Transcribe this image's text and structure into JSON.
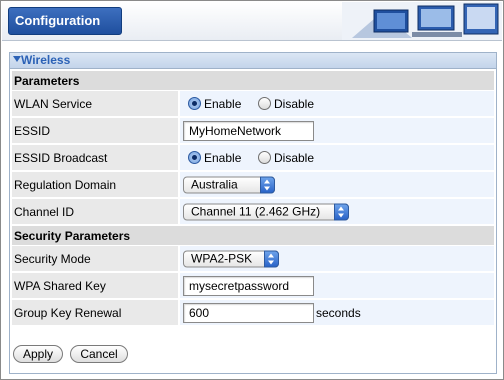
{
  "header": {
    "title": "Configuration"
  },
  "section": {
    "label": "Wireless"
  },
  "parameters_heading": "Parameters",
  "security_heading": "Security Parameters",
  "wlan_service": {
    "label": "WLAN Service",
    "enable": "Enable",
    "disable": "Disable",
    "selected": "Enable"
  },
  "essid": {
    "label": "ESSID",
    "value": "MyHomeNetwork"
  },
  "essid_broadcast": {
    "label": "ESSID Broadcast",
    "enable": "Enable",
    "disable": "Disable",
    "selected": "Enable"
  },
  "regulation_domain": {
    "label": "Regulation Domain",
    "value": "Australia"
  },
  "channel_id": {
    "label": "Channel ID",
    "value": "Channel 11 (2.462 GHz)"
  },
  "security_mode": {
    "label": "Security Mode",
    "value": "WPA2-PSK"
  },
  "wpa_key": {
    "label": "WPA Shared Key",
    "value": "mysecretpassword"
  },
  "group_key": {
    "label": "Group Key Renewal",
    "value": "600",
    "unit": "seconds"
  },
  "buttons": {
    "apply": "Apply",
    "cancel": "Cancel"
  },
  "colors": {
    "accent": "#2c62b6",
    "label_bg": "#e9e9e9",
    "value_bg": "#eef4fd",
    "heading_bg": "#dcdcdc"
  }
}
